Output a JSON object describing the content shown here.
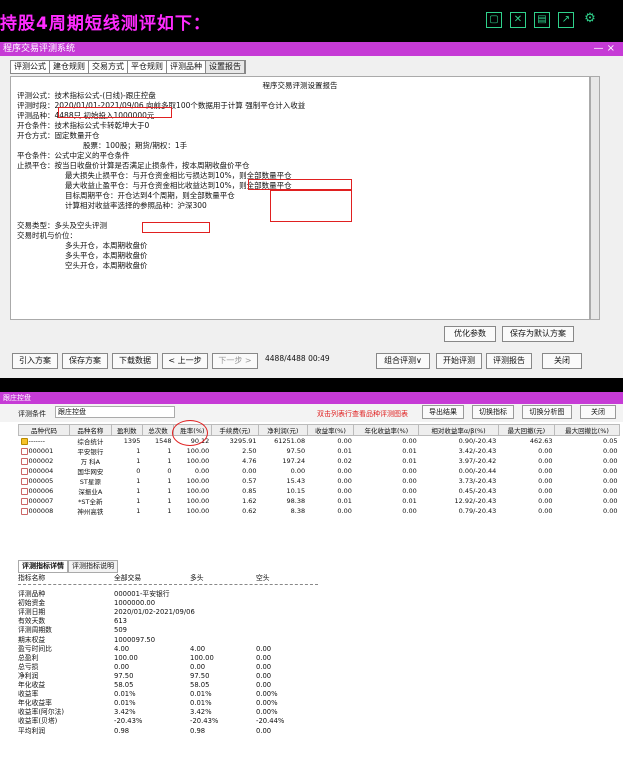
{
  "headline": "持股4周期短线测评如下：",
  "window1": {
    "title": "程序交易评测系统",
    "controls": "—  ×",
    "tabs": [
      "评测公式",
      "建仓规则",
      "交易方式",
      "平仓规则",
      "评测品种",
      "设置报告"
    ],
    "report_title": "程序交易评测设置报告",
    "lines": [
      "评测公式：技术指标公式-(日线)-跟庄控盘",
      "评测时段：2020/01/01-2021/09/06 向前多取100个数据用于计算 强制平仓计入收益",
      "评测品种：4488只 初始投入1000000元",
      "开仓条件：技术指标公式卡转乾坤大于0",
      "开仓方式：固定数量开仓",
      "股票：100股；期货/期权：1手",
      "平仓条件：公式中定义的平仓条件",
      "止损平仓：按当日收盘价计算是否满足止损条件，按本周期收盘价平仓",
      "最大损失止损平仓：与开仓资金相比亏损达到10%，则全部数量平仓",
      "最大收益止盈平仓：与开仓资金相比收益达到10%，则全部数量平仓",
      "目标周期平仓：开仓达到4个周期，则全部数量平仓",
      "计算相对收益率选择的参照品种：沪深300",
      "交易类型：多头及空头评测",
      "交易时机与价位：",
      "多头开仓，本周期收盘价",
      "多头平仓，本周期收盘价",
      "空头开仓，本周期收盘价"
    ],
    "opt_button": "优化参数",
    "save_default_button": "保存为默认方案",
    "bottom_buttons": [
      "引入方案",
      "保存方案",
      "下载数据",
      "< 上一步",
      "下一步 >"
    ],
    "progress": "4488/4488 00:49",
    "combo_button": "组合评测∨",
    "start_button": "开始评测",
    "report_button": "评测报告",
    "close_button": "关闭"
  },
  "window2": {
    "title": "跟庄控盘",
    "cond_label": "评测条件",
    "cond_value": "跟庄控盘",
    "hint": "双击列表行查看品种评测图表",
    "buttons": [
      "导出结果",
      "切换指标",
      "切换分析图",
      "关闭"
    ],
    "columns": [
      "品种代码",
      "品种名称",
      "盈利数",
      "总次数",
      "胜率(%)",
      "手续费(元)",
      "净利润(元)",
      "收益率(%)",
      "年化收益率(%)",
      "相对收益率α/β(%)",
      "最大回撤(元)",
      "最大回撤比(%)"
    ],
    "rows": [
      [
        "-------",
        "综合统计",
        "1395",
        "1548",
        "90.12",
        "3295.91",
        "61251.08",
        "0.00",
        "0.00",
        "0.90/-20.43",
        "462.63",
        "0.05"
      ],
      [
        "000001",
        "平安银行",
        "1",
        "1",
        "100.00",
        "2.50",
        "97.50",
        "0.01",
        "0.01",
        "3.42/-20.43",
        "0.00",
        "0.00"
      ],
      [
        "000002",
        "万 科A",
        "1",
        "1",
        "100.00",
        "4.76",
        "197.24",
        "0.02",
        "0.01",
        "3.97/-20.42",
        "0.00",
        "0.00"
      ],
      [
        "000004",
        "国华网安",
        "0",
        "0",
        "0.00",
        "0.00",
        "0.00",
        "0.00",
        "0.00",
        "0.00/-20.44",
        "0.00",
        "0.00"
      ],
      [
        "000005",
        "ST星源",
        "1",
        "1",
        "100.00",
        "0.57",
        "15.43",
        "0.00",
        "0.00",
        "3.73/-20.43",
        "0.00",
        "0.00"
      ],
      [
        "000006",
        "深振业A",
        "1",
        "1",
        "100.00",
        "0.85",
        "10.15",
        "0.00",
        "0.00",
        "0.45/-20.43",
        "0.00",
        "0.00"
      ],
      [
        "000007",
        "*ST全新",
        "1",
        "1",
        "100.00",
        "1.62",
        "98.38",
        "0.01",
        "0.01",
        "12.92/-20.43",
        "0.00",
        "0.00"
      ],
      [
        "000008",
        "神州高铁",
        "1",
        "1",
        "100.00",
        "0.62",
        "8.38",
        "0.00",
        "0.00",
        "0.79/-20.43",
        "0.00",
        "0.00"
      ]
    ],
    "detail_tabs": [
      "评测指标详情",
      "评测指标说明"
    ],
    "detail_header": [
      "指标名称",
      "全部交易",
      "多头",
      "空头"
    ],
    "detail_rows": [
      [
        "评测品种",
        "000001-平安银行",
        "",
        ""
      ],
      [
        "初始资金",
        "1000000.00",
        "",
        ""
      ],
      [
        "评测日期",
        "2020/01/02-2021/09/06",
        "",
        ""
      ],
      [
        "有效天数",
        "613",
        "",
        ""
      ],
      [
        "评测周期数",
        "509",
        "",
        ""
      ],
      [
        "期末权益",
        "1000097.50",
        "",
        ""
      ],
      [
        "盈亏时间比",
        "4.00",
        "4.00",
        "0.00"
      ],
      [
        "总盈利",
        "100.00",
        "100.00",
        "0.00"
      ],
      [
        "总亏损",
        "0.00",
        "0.00",
        "0.00"
      ],
      [
        "净利润",
        "97.50",
        "97.50",
        "0.00"
      ],
      [
        "年化收益",
        "58.05",
        "58.05",
        "0.00"
      ],
      [
        "收益率",
        "0.01%",
        "0.01%",
        "0.00%"
      ],
      [
        "年化收益率",
        "0.01%",
        "0.01%",
        "0.00%"
      ],
      [
        "收益率(阿尔法)",
        "3.42%",
        "3.42%",
        "0.00%"
      ],
      [
        "收益率(贝塔)",
        "-20.43%",
        "-20.43%",
        "-20.44%"
      ],
      [
        "平均利润",
        "0.98",
        "0.98",
        "0.00"
      ]
    ]
  }
}
